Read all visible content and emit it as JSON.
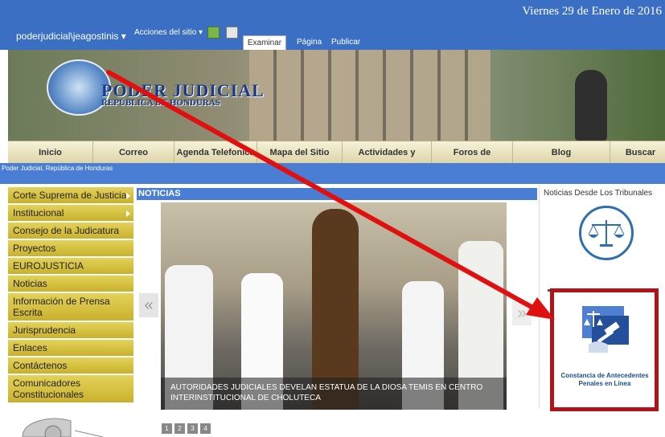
{
  "topbar": {
    "date": "Viernes 29 de Enero de 2016",
    "user": "poderjudicial\\jeagostinis",
    "acciones": "Acciones del sitio",
    "tabs": [
      "Examinar",
      "Página",
      "Publicar"
    ]
  },
  "banner": {
    "logo_title": "PODER JUDICIAL",
    "logo_subtitle": "REPÚBLICA DE HONDURAS"
  },
  "nav": {
    "items": [
      "Inicio",
      "Correo",
      "Agenda Telefonica",
      "Mapa del Sitio",
      "Actividades y eventos",
      "Foros de Discusión",
      "Blog",
      "Buscar"
    ]
  },
  "breadcrumb": "Poder Judicial, República de Honduras",
  "sidebar": {
    "items": [
      {
        "label": "Corte Suprema de Justicia",
        "submenu": true
      },
      {
        "label": "Institucional",
        "submenu": true
      },
      {
        "label": "Consejo de la Judicatura",
        "submenu": false
      },
      {
        "label": "Proyectos",
        "submenu": false
      },
      {
        "label": "EUROJUSTICIA",
        "submenu": false
      },
      {
        "label": "Noticias",
        "submenu": false
      },
      {
        "label": "Información de Prensa Escrita",
        "submenu": false
      },
      {
        "label": "Jurisprudencia",
        "submenu": false
      },
      {
        "label": "Enlaces",
        "submenu": false
      },
      {
        "label": "Contáctenos",
        "submenu": false
      },
      {
        "label": "Comunicadores Constitucionales",
        "submenu": false
      }
    ]
  },
  "news": {
    "header": "NOTICIAS",
    "caption": "AUTORIDADES JUDICIALES DEVELAN ESTATUA DE LA DIOSA TEMIS EN CENTRO INTERINSTITUCIONAL DE CHOLUTECA",
    "pages": [
      "1",
      "2",
      "3",
      "4"
    ],
    "prev": "«",
    "next": "»"
  },
  "right": {
    "title": "Noticias Desde Los Tribunales",
    "cert_text": "Constancia de Antecedentes Penales en Línea"
  },
  "colors": {
    "topbar": "#3a6fc4",
    "sidebar_gold": "#d4c040",
    "annotation_red": "#e01010",
    "highlight_box": "#b0141a"
  }
}
